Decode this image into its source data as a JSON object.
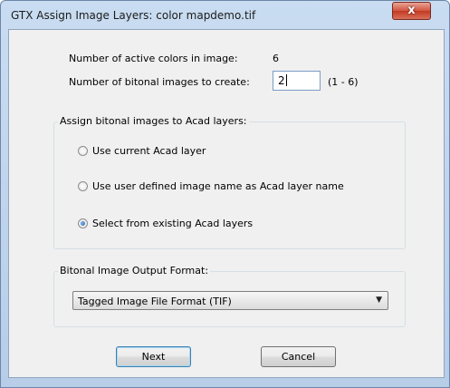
{
  "window": {
    "title": "GTX Assign Image Layers: color mapdemo.tif",
    "close_label": "x"
  },
  "info": {
    "active_colors_label": "Number of active colors in image:",
    "active_colors_value": "6",
    "bitonal_count_label": "Number of bitonal images to create:",
    "bitonal_count_value": "2",
    "bitonal_count_range": "(1 - 6)"
  },
  "assign_group": {
    "legend": "Assign bitonal images to Acad layers:",
    "options": [
      {
        "label": "Use current Acad layer",
        "checked": false
      },
      {
        "label": "Use user defined image name as Acad layer name",
        "checked": false
      },
      {
        "label": "Select from existing Acad layers",
        "checked": true
      }
    ]
  },
  "format_group": {
    "legend": "Bitonal Image Output Format:",
    "selected": "Tagged Image File Format (TIF)"
  },
  "buttons": {
    "next": "Next",
    "cancel": "Cancel"
  }
}
